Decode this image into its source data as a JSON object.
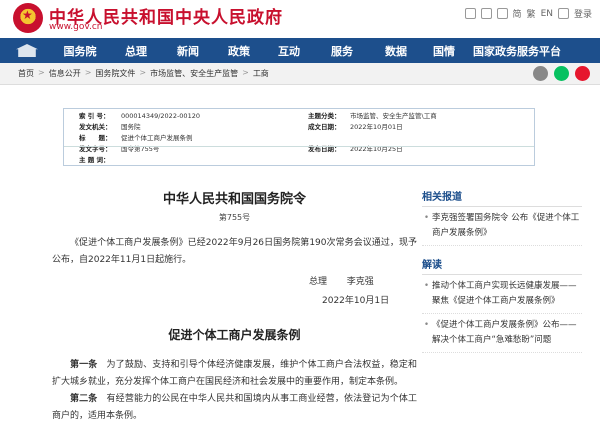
{
  "header": {
    "title": "中华人民共和国中央人民政府",
    "url": "www.gov.cn",
    "links": [
      "简",
      "繁",
      "EN",
      "登录"
    ]
  },
  "nav": {
    "items": [
      "国务院",
      "总理",
      "新闻",
      "政策",
      "互动",
      "服务",
      "数据",
      "国情",
      "国家政务服务平台"
    ]
  },
  "breadcrumb": [
    "首页",
    "信息公开",
    "国务院文件",
    "市场监管、安全生产监管",
    "工商"
  ],
  "info": {
    "left": [
      {
        "k": "索 引 号：",
        "v": "000014349/2022-00120"
      },
      {
        "k": "发文机关：",
        "v": "国务院"
      },
      {
        "k": "标　　题：",
        "v": "促进个体工商户发展条例"
      },
      {
        "k": "发文字号：",
        "v": "国令第755号"
      },
      {
        "k": "主 题 词：",
        "v": ""
      }
    ],
    "right": [
      {
        "k": "主题分类：",
        "v": "市场监管、安全生产监管\\工商"
      },
      {
        "k": "成文日期：",
        "v": "2022年10月01日"
      },
      {
        "k": "",
        "v": ""
      },
      {
        "k": "发布日期：",
        "v": "2022年10月25日"
      },
      {
        "k": "",
        "v": ""
      }
    ]
  },
  "document": {
    "title": "中华人民共和国国务院令",
    "number": "第755号",
    "intro": "《促进个体工商户发展条例》已经2022年9月26日国务院第190次常务会议通过，现予公布，自2022年11月1日起施行。",
    "signer_role": "总理",
    "signer_name": "李克强",
    "sign_date": "2022年10月1日",
    "law_title": "促进个体工商户发展条例",
    "articles": [
      {
        "no": "第一条",
        "text": "为了鼓励、支持和引导个体经济健康发展，维护个体工商户合法权益，稳定和扩大城乡就业，充分发挥个体工商户在国民经济和社会发展中的重要作用，制定本条例。"
      },
      {
        "no": "第二条",
        "text": "有经营能力的公民在中华人民共和国境内从事工商业经营，依法登记为个体工商户的，适用本条例。"
      }
    ]
  },
  "sidebar": {
    "related_head": "相关报道",
    "related": [
      "李克强签署国务院令 公布《促进个体工商户发展条例》"
    ],
    "interpret_head": "解读",
    "interpret": [
      "推动个体工商户实现长远健康发展——聚焦《促进个体工商户发展条例》",
      "《促进个体工商户发展条例》公布——解决个体工商户“急难愁盼”问题"
    ]
  },
  "colors": {
    "brand_red": "#c8102e",
    "nav_blue": "#1d4f8c"
  }
}
